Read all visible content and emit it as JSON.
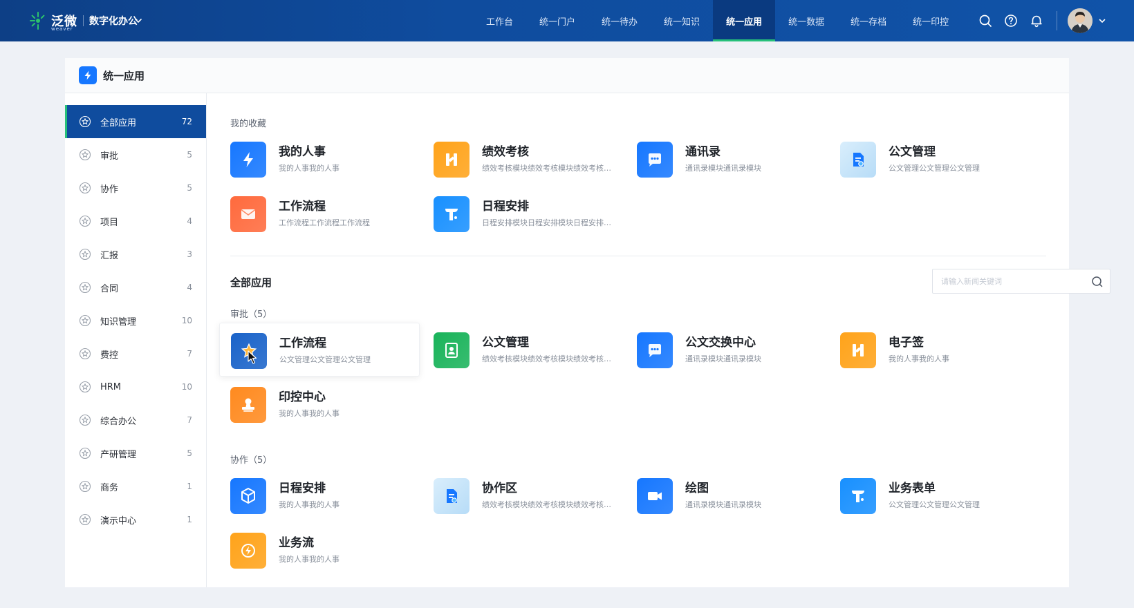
{
  "topbar": {
    "brand_name": "泛微",
    "brand_en": "weaver",
    "brand_sub": "数字化办公",
    "nav": [
      "工作台",
      "统一门户",
      "统一待办",
      "统一知识",
      "统一应用",
      "统一数据",
      "统一存档",
      "统一印控"
    ],
    "nav_active_index": 4,
    "icons": [
      "search-icon",
      "help-icon",
      "bell-icon",
      "avatar",
      "chevron-down-icon"
    ]
  },
  "panel": {
    "title": "统一应用"
  },
  "sidebar": {
    "items": [
      {
        "label": "全部应用",
        "count": "72"
      },
      {
        "label": "审批",
        "count": "5"
      },
      {
        "label": "协作",
        "count": "5"
      },
      {
        "label": "项目",
        "count": "4"
      },
      {
        "label": "汇报",
        "count": "3"
      },
      {
        "label": "合同",
        "count": "4"
      },
      {
        "label": "知识管理",
        "count": "10"
      },
      {
        "label": "费控",
        "count": "7"
      },
      {
        "label": "HRM",
        "count": "10"
      },
      {
        "label": "综合办公",
        "count": "7"
      },
      {
        "label": "产研管理",
        "count": "5"
      },
      {
        "label": "商务",
        "count": "1"
      },
      {
        "label": "演示中心",
        "count": "1"
      }
    ],
    "active_index": 0
  },
  "favorites": {
    "label": "我的收藏",
    "apps": [
      {
        "name": "我的人事",
        "desc": "我的人事我的人事",
        "icon": "bolt-icon",
        "color": "#1677ff"
      },
      {
        "name": "绩效考核",
        "desc": "绩效考核模块绩效考核模块绩效考核模块",
        "icon": "h-icon",
        "color": "#ffa31a"
      },
      {
        "name": "通讯录",
        "desc": "通讯录模块通讯录模块",
        "icon": "chat-icon",
        "color": "#1677ff"
      },
      {
        "name": "公文管理",
        "desc": "公文管理公文管理公文管理",
        "icon": "document-icon",
        "color": "#bfe3fb"
      },
      {
        "name": "工作流程",
        "desc": "工作流程工作流程工作流程",
        "icon": "mail-icon",
        "color": "#ff6a3d"
      },
      {
        "name": "日程安排",
        "desc": "日程安排模块日程安排模块日程安排模块",
        "icon": "t-icon",
        "color": "#1890ff"
      }
    ]
  },
  "all_apps": {
    "title": "全部应用",
    "search_placeholder": "请输入新闻关键词",
    "groups": [
      {
        "label": "审批（5）",
        "apps": [
          {
            "name": "工作流程",
            "desc": "公文管理公文管理公文管理",
            "icon": "star-icon",
            "color": "#1a63c9"
          },
          {
            "name": "公文管理",
            "desc": "绩效考核模块绩效考核模块绩效考核模块",
            "icon": "contact-card-icon",
            "color": "#19b35a"
          },
          {
            "name": "公文交换中心",
            "desc": "通讯录模块通讯录模块",
            "icon": "chat-icon",
            "color": "#1677ff"
          },
          {
            "name": "电子签",
            "desc": "我的人事我的人事",
            "icon": "h-icon",
            "color": "#ffa31a"
          },
          {
            "name": "印控中心",
            "desc": "我的人事我的人事",
            "icon": "stamp-icon",
            "color": "#ff8a1f"
          }
        ]
      },
      {
        "label": "协作（5）",
        "apps": [
          {
            "name": "日程安排",
            "desc": "我的人事我的人事",
            "icon": "cube-icon",
            "color": "#1677ff"
          },
          {
            "name": "协作区",
            "desc": "绩效考核模块绩效考核模块绩效考核模块",
            "icon": "document-icon",
            "color": "#bfe3fb"
          },
          {
            "name": "绘图",
            "desc": "通讯录模块通讯录模块",
            "icon": "video-icon",
            "color": "#1677ff"
          },
          {
            "name": "业务表单",
            "desc": "公文管理公文管理公文管理",
            "icon": "t-icon",
            "color": "#1890ff"
          },
          {
            "name": "业务流",
            "desc": "我的人事我的人事",
            "icon": "lightning-circle-icon",
            "color": "#ffa31a"
          }
        ]
      }
    ]
  }
}
